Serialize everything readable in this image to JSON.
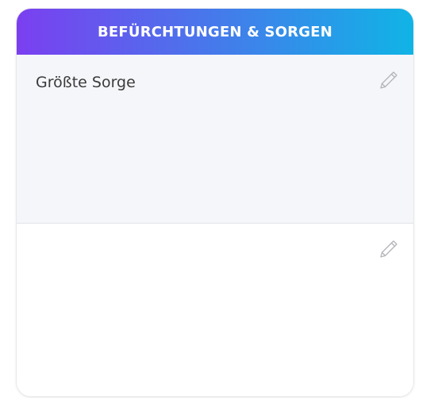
{
  "card": {
    "title": "BEFÜRCHTUNGEN & SORGEN",
    "gradient_start": "#7b3ff0",
    "gradient_end": "#10b4e6"
  },
  "sections": [
    {
      "text": "Größte Sorge",
      "icon": "pencil-icon"
    },
    {
      "text": "",
      "icon": "pencil-icon"
    }
  ]
}
